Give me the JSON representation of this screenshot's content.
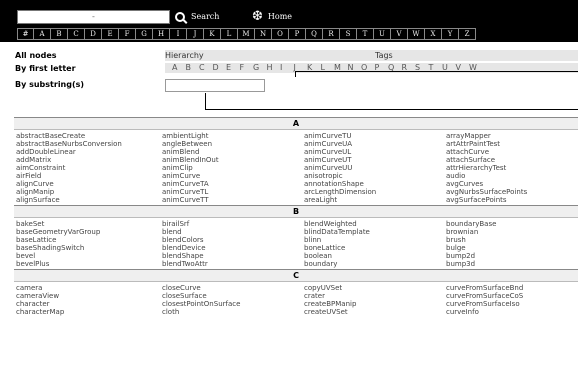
{
  "topbar": {
    "search_box_value": "-",
    "search_label": "Search",
    "home_label": "Home",
    "letters": [
      "#",
      "A",
      "B",
      "C",
      "D",
      "E",
      "F",
      "G",
      "H",
      "I",
      "J",
      "K",
      "L",
      "M",
      "N",
      "O",
      "P",
      "Q",
      "R",
      "S",
      "T",
      "U",
      "V",
      "W",
      "X",
      "Y",
      "Z"
    ]
  },
  "filters": {
    "all_nodes": "All nodes",
    "by_first_letter": "By first letter",
    "by_substring": "By substring(s)",
    "hierarchy": "Hierarchy",
    "tags": "Tags",
    "substring_value": "",
    "letter_options": [
      "A",
      "B",
      "C",
      "D",
      "E",
      "F",
      "G",
      "H",
      "I",
      "J",
      "K",
      "L",
      "M",
      "N",
      "O",
      "P",
      "Q",
      "R",
      "S",
      "T",
      "U",
      "V",
      "W"
    ]
  },
  "sections": [
    {
      "letter": "A",
      "rows": [
        [
          "abstractBaseCreate",
          "ambientLight",
          "animCurveTU",
          "arrayMapper"
        ],
        [
          "abstractBaseNurbsConversion",
          "angleBetween",
          "animCurveUA",
          "artAttrPaintTest"
        ],
        [
          "addDoubleLinear",
          "animBlend",
          "animCurveUL",
          "attachCurve"
        ],
        [
          "addMatrix",
          "animBlendInOut",
          "animCurveUT",
          "attachSurface"
        ],
        [
          "aimConstraint",
          "animClip",
          "animCurveUU",
          "attrHierarchyTest"
        ],
        [
          "airField",
          "animCurve",
          "anisotropic",
          "audio"
        ],
        [
          "alignCurve",
          "animCurveTA",
          "annotationShape",
          "avgCurves"
        ],
        [
          "alignManip",
          "animCurveTL",
          "arcLengthDimension",
          "avgNurbsSurfacePoints"
        ],
        [
          "alignSurface",
          "animCurveTT",
          "areaLight",
          "avgSurfacePoints"
        ]
      ]
    },
    {
      "letter": "B",
      "rows": [
        [
          "bakeSet",
          "birailSrf",
          "blendWeighted",
          "boundaryBase"
        ],
        [
          "baseGeometryVarGroup",
          "blend",
          "blindDataTemplate",
          "brownian"
        ],
        [
          "baseLattice",
          "blendColors",
          "blinn",
          "brush"
        ],
        [
          "baseShadingSwitch",
          "blendDevice",
          "boneLattice",
          "bulge"
        ],
        [
          "bevel",
          "blendShape",
          "boolean",
          "bump2d"
        ],
        [
          "bevelPlus",
          "blendTwoAttr",
          "boundary",
          "bump3d"
        ]
      ]
    },
    {
      "letter": "C",
      "rows": [
        [
          "camera",
          "closeCurve",
          "copyUVSet",
          "curveFromSurfaceBnd"
        ],
        [
          "cameraView",
          "closeSurface",
          "crater",
          "curveFromSurfaceCoS"
        ],
        [
          "character",
          "closestPointOnSurface",
          "createBPManip",
          "curveFromSurfaceIso"
        ],
        [
          "characterMap",
          "cloth",
          "createUVSet",
          "curveInfo"
        ]
      ]
    }
  ]
}
